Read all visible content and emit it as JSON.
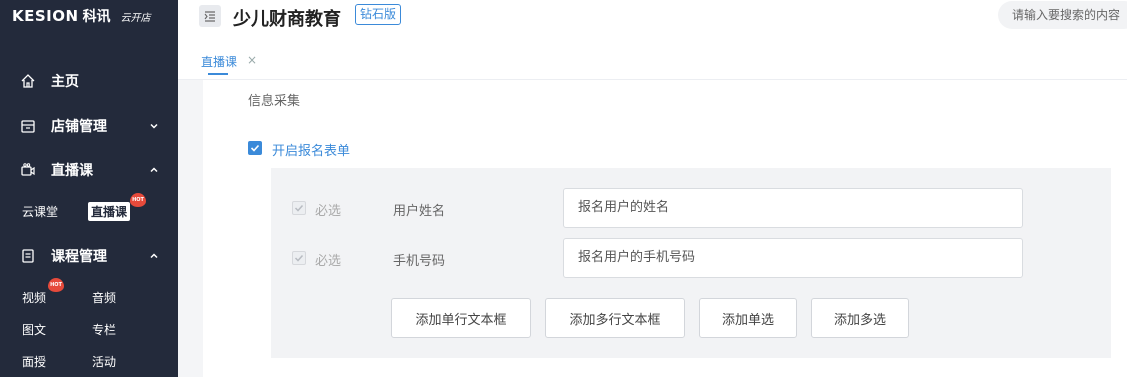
{
  "brand": {
    "logo_text": "KESION",
    "logo_cn": "科讯",
    "logo_sub": "云开店"
  },
  "sidebar": {
    "items": [
      {
        "label": "主页",
        "icon": "home-icon"
      },
      {
        "label": "店铺管理",
        "icon": "store-icon",
        "expanded": false
      },
      {
        "label": "直播课",
        "icon": "live-icon",
        "expanded": true
      },
      {
        "label": "课程管理",
        "icon": "course-icon",
        "expanded": true
      }
    ],
    "live_sub": [
      {
        "label": "云课堂",
        "active": false
      },
      {
        "label": "直播课",
        "active": true,
        "badge": "HOT"
      }
    ],
    "course_sub": [
      {
        "label": "视频",
        "badge": "HOT"
      },
      {
        "label": "音频"
      },
      {
        "label": "图文"
      },
      {
        "label": "专栏"
      },
      {
        "label": "面授"
      },
      {
        "label": "活动"
      }
    ]
  },
  "header": {
    "shop_title": "少儿财商教育",
    "edition": "钻石版",
    "search_placeholder": "请输入要搜索的内容"
  },
  "tabs": [
    {
      "label": "直播课",
      "active": true,
      "close": "×"
    }
  ],
  "form": {
    "section_title": "信息采集",
    "enable_label": "开启报名表单",
    "enable_checked": true,
    "fields": [
      {
        "required_label": "必选",
        "label": "用户姓名",
        "value": "报名用户的姓名"
      },
      {
        "required_label": "必选",
        "label": "手机号码",
        "value": "报名用户的手机号码"
      }
    ],
    "buttons": [
      "添加单行文本框",
      "添加多行文本框",
      "添加单选",
      "添加多选"
    ]
  },
  "colors": {
    "sidebar_bg": "#232a3b",
    "accent": "#3b8ad9",
    "hot_badge": "#e64a3b"
  }
}
